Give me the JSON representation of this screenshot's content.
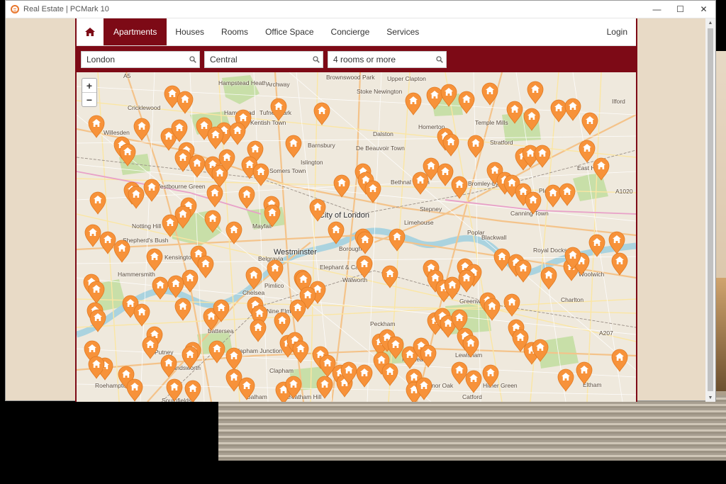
{
  "window": {
    "title": "Real Estate | PCMark 10",
    "controls": {
      "minimize": "—",
      "maximize": "☐",
      "close": "✕"
    }
  },
  "nav": {
    "items": [
      {
        "label": "Apartments",
        "active": true
      },
      {
        "label": "Houses"
      },
      {
        "label": "Rooms"
      },
      {
        "label": "Office Space"
      },
      {
        "label": "Concierge"
      },
      {
        "label": "Services"
      }
    ],
    "login": "Login"
  },
  "search": {
    "city": "London",
    "area": "Central",
    "rooms": "4 rooms or more"
  },
  "map": {
    "zoom_in": "+",
    "zoom_out": "−",
    "labels": [
      "Cricklewood",
      "Hampstead",
      "Archway",
      "Brownswood Park",
      "Upper Clapton",
      "Stoke Newington",
      "Hampstead Heath",
      "Tufnell Park",
      "Kentish Town",
      "Willesden",
      "Homerton",
      "Temple Mills",
      "Ilford",
      "Dalston",
      "Barnsbury",
      "De Beauvoir Town",
      "Stratford",
      "Somers Town",
      "Islington",
      "East Ham",
      "Westbourne Green",
      "Bethnal Green",
      "Bromley-by-Bow",
      "Plaistow",
      "City of London",
      "Stepney",
      "Limehouse",
      "Canning Town",
      "Notting Hill",
      "Shepherd's Bush",
      "Mayfair",
      "Westminster",
      "Borough",
      "Poplar",
      "Blackwall",
      "Royal Docks",
      "Kensington",
      "Hammersmith",
      "Belgravia",
      "Elephant & Castle",
      "Walworth",
      "Pimlico",
      "Chelsea",
      "Nine Elms",
      "Greenwich",
      "Charlton",
      "Woolwich",
      "Battersea",
      "Peckham",
      "Putney",
      "Clapham Junction",
      "Lewisham",
      "Wandsworth",
      "Clapham",
      "Nunhead",
      "Roehampton",
      "Honor Oak",
      "Hither Green",
      "Eltham",
      "Balham",
      "Streatham Hill",
      "Catford",
      "Southfields",
      "A1020",
      "A207",
      "A5"
    ]
  }
}
